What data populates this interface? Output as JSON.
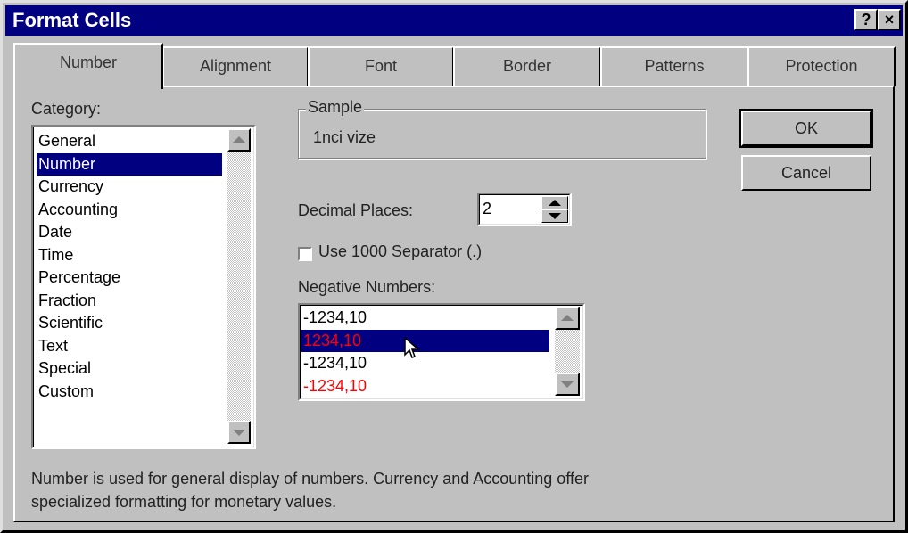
{
  "window": {
    "title": "Format Cells",
    "help_label": "?",
    "close_label": "×"
  },
  "tabs": [
    "Number",
    "Alignment",
    "Font",
    "Border",
    "Patterns",
    "Protection"
  ],
  "category": {
    "label": "Category:",
    "items": [
      "General",
      "Number",
      "Currency",
      "Accounting",
      "Date",
      "Time",
      "Percentage",
      "Fraction",
      "Scientific",
      "Text",
      "Special",
      "Custom"
    ],
    "selected": "Number"
  },
  "sample": {
    "label": "Sample",
    "value": "1nci vize"
  },
  "decimal": {
    "label": "Decimal Places:",
    "value": "2"
  },
  "separator": {
    "label": "Use 1000 Separator (.)",
    "checked": false
  },
  "negative": {
    "label": "Negative Numbers:",
    "items": [
      "-1234,10",
      "1234,10",
      "-1234,10",
      "-1234,10"
    ],
    "selected_index": 1,
    "red_color": "#ff0000"
  },
  "buttons": {
    "ok": "OK",
    "cancel": "Cancel"
  },
  "description": {
    "line1": "Number is used for general display of numbers.  Currency and Accounting offer",
    "line2": "specialized formatting for monetary values."
  },
  "colors": {
    "title_bar": "#000080",
    "selection": "#000080",
    "face": "#c0c0c0"
  }
}
